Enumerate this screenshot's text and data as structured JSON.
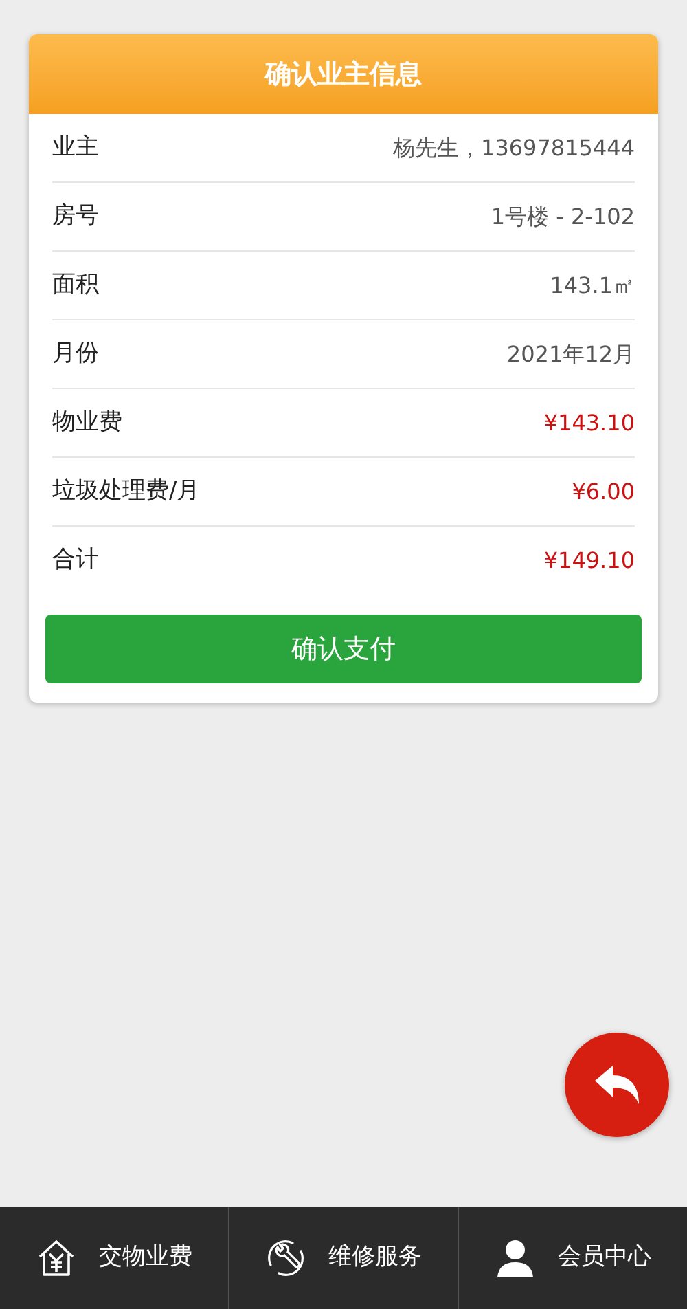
{
  "card": {
    "title": "确认业主信息",
    "rows": [
      {
        "label": "业主",
        "value": "杨先生，13697815444",
        "kind": "plain"
      },
      {
        "label": "房号",
        "value": "1号楼 - 2-102",
        "kind": "plain"
      },
      {
        "label": "面积",
        "value": "143.1㎡",
        "kind": "plain"
      },
      {
        "label": "月份",
        "value": "2021年12月",
        "kind": "plain"
      },
      {
        "label": "物业费",
        "value": "¥143.10",
        "kind": "money"
      },
      {
        "label": "垃圾处理费/月",
        "value": "¥6.00",
        "kind": "money"
      },
      {
        "label": "合计",
        "value": "¥149.10",
        "kind": "money"
      }
    ],
    "button": "确认支付"
  },
  "nav": [
    {
      "label": "交物业费",
      "kind": "fee"
    },
    {
      "label": "维修服务",
      "kind": "repair"
    },
    {
      "label": "会员中心",
      "kind": "member"
    }
  ]
}
